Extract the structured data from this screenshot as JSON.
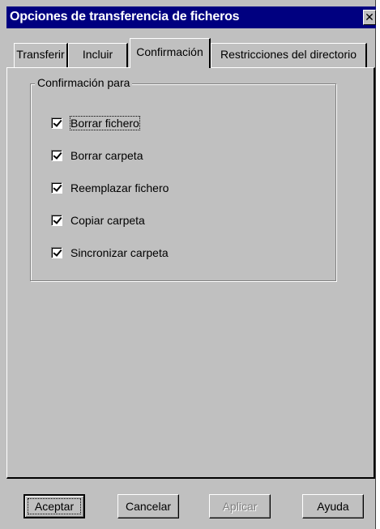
{
  "window": {
    "title": "Opciones de transferencia de ficheros",
    "close_glyph": "✕"
  },
  "tabs": [
    {
      "label": "Transferir",
      "active": false
    },
    {
      "label": "Incluir",
      "active": false
    },
    {
      "label": "Confirmación",
      "active": true
    },
    {
      "label": "Restricciones del directorio",
      "active": false
    }
  ],
  "group": {
    "label": "Confirmación para",
    "items": [
      {
        "label": "Borrar fichero",
        "checked": true,
        "focused": true
      },
      {
        "label": "Borrar carpeta",
        "checked": true,
        "focused": false
      },
      {
        "label": "Reemplazar fichero",
        "checked": true,
        "focused": false
      },
      {
        "label": "Copiar carpeta",
        "checked": true,
        "focused": false
      },
      {
        "label": "Sincronizar carpeta",
        "checked": true,
        "focused": false
      }
    ]
  },
  "buttons": {
    "ok": "Aceptar",
    "cancel": "Cancelar",
    "apply": "Aplicar",
    "help": "Ayuda"
  },
  "colors": {
    "titlebar": "#000080",
    "face": "#c0c0c0",
    "disabled_text": "#808080"
  }
}
